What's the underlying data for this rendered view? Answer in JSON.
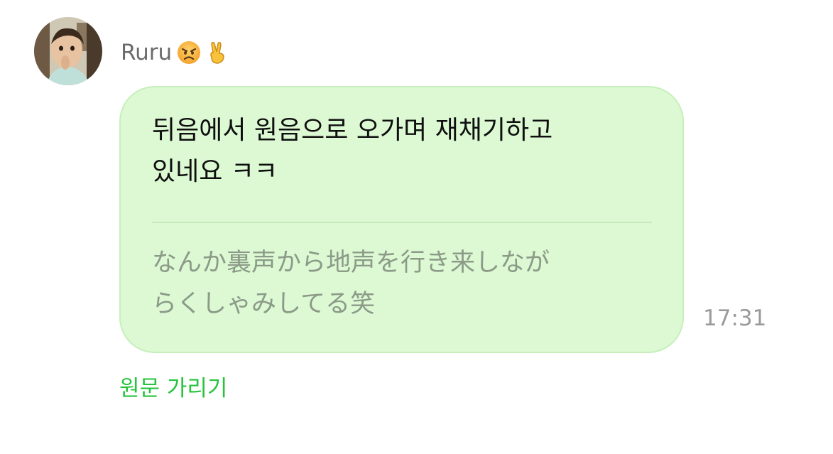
{
  "sender": {
    "name": "Ruru",
    "emojis": [
      "😠",
      "✌"
    ]
  },
  "message": {
    "translated_text": "뒤음에서 원음으로 오가며 재채기하고\n있네요 ㅋㅋ",
    "original_text": "なんか裏声から地声を行き来しなが\nらくしゃみしてる笑",
    "time": "17:31"
  },
  "actions": {
    "hide_original_label": "원문 가리기"
  },
  "colors": {
    "bubble_bg": "#dcf9d3",
    "bubble_border": "#c6efbb",
    "link_green": "#26c33d",
    "original_text": "#8c9a88"
  }
}
